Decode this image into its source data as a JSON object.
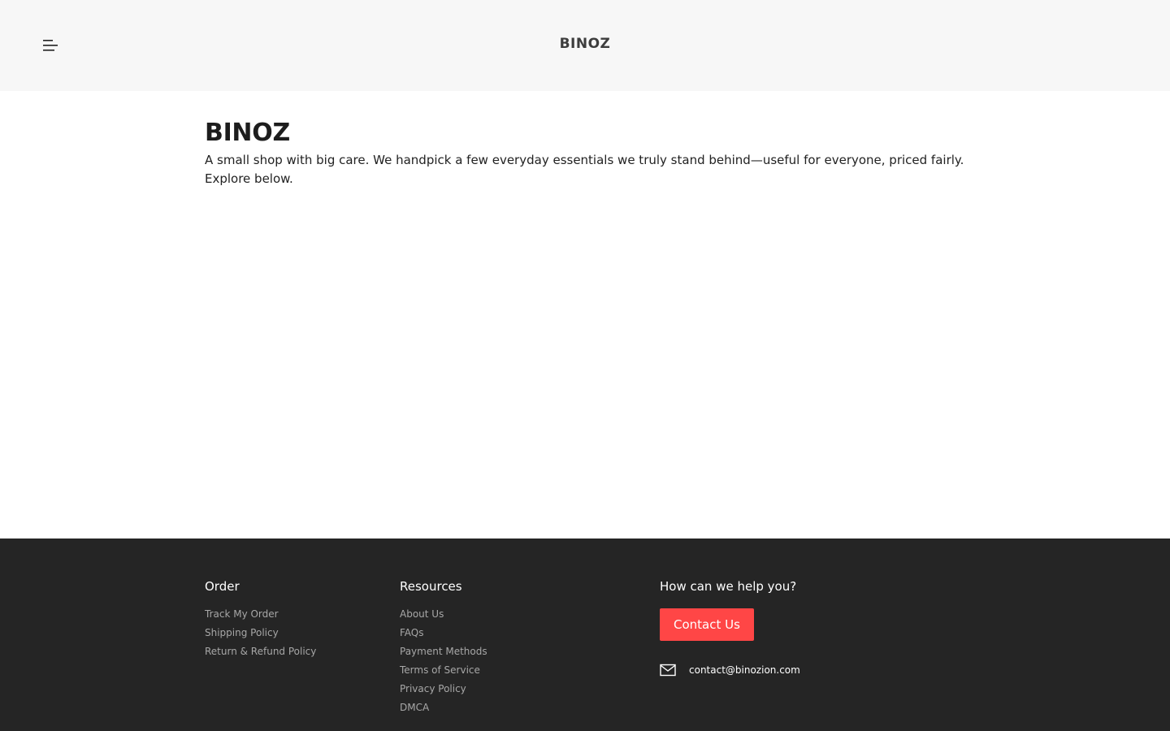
{
  "header": {
    "menu_icon": "menu-icon",
    "brand": "BINOZ"
  },
  "hero": {
    "title": "BINOZ",
    "description": "A small shop with big care. We handpick a few everyday essentials we truly stand behind—useful for everyone, priced fairly. Explore below."
  },
  "footer": {
    "order": {
      "heading": "Order",
      "links": [
        "Track My Order",
        "Shipping Policy",
        "Return & Refund Policy"
      ]
    },
    "resources": {
      "heading": "Resources",
      "links": [
        "About Us",
        "FAQs",
        "Payment Methods",
        "Terms of Service",
        "Privacy Policy",
        "DMCA"
      ]
    },
    "help": {
      "heading": "How can we help you?",
      "button_label": "Contact Us",
      "email_icon": "mail-icon",
      "email": "contact@binozion.com"
    }
  },
  "colors": {
    "topbar_bg": "#f7f7f7",
    "footer_bg": "#252525",
    "accent": "#ff4646"
  }
}
